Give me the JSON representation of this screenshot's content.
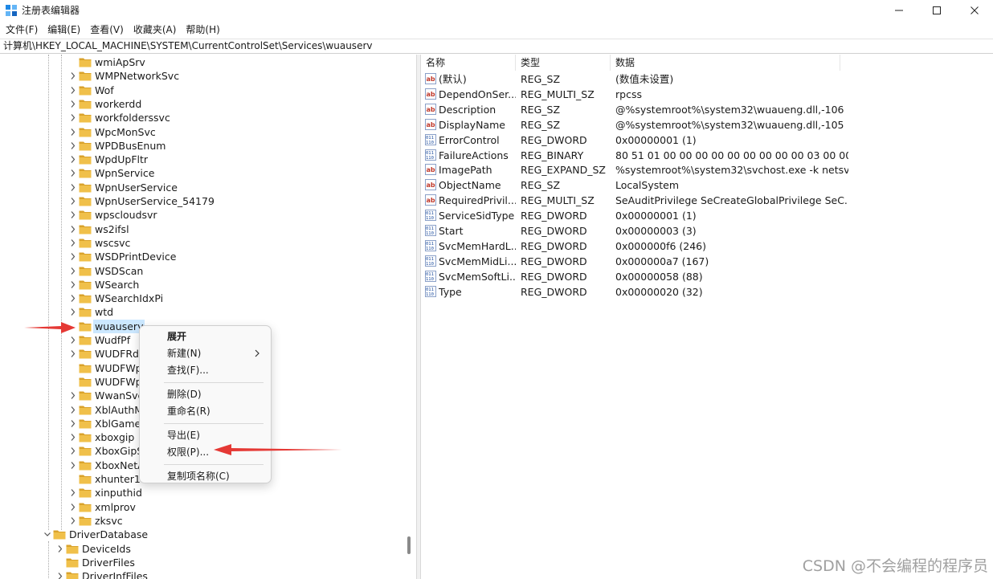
{
  "window": {
    "title": "注册表编辑器",
    "minimize_icon": "minimize-icon",
    "maximize_icon": "maximize-icon",
    "close_icon": "close-icon"
  },
  "menubar": [
    {
      "label": "文件(F)"
    },
    {
      "label": "编辑(E)"
    },
    {
      "label": "查看(V)"
    },
    {
      "label": "收藏夹(A)"
    },
    {
      "label": "帮助(H)"
    }
  ],
  "address": "计算机\\HKEY_LOCAL_MACHINE\\SYSTEM\\CurrentControlSet\\Services\\wuauserv",
  "tree": {
    "items": [
      {
        "label": "wmiApSrv",
        "level": 2,
        "expander": false
      },
      {
        "label": "WMPNetworkSvc",
        "level": 2,
        "expander": true
      },
      {
        "label": "Wof",
        "level": 2,
        "expander": true
      },
      {
        "label": "workerdd",
        "level": 2,
        "expander": true
      },
      {
        "label": "workfolderssvc",
        "level": 2,
        "expander": true
      },
      {
        "label": "WpcMonSvc",
        "level": 2,
        "expander": true
      },
      {
        "label": "WPDBusEnum",
        "level": 2,
        "expander": true
      },
      {
        "label": "WpdUpFltr",
        "level": 2,
        "expander": true
      },
      {
        "label": "WpnService",
        "level": 2,
        "expander": true
      },
      {
        "label": "WpnUserService",
        "level": 2,
        "expander": true
      },
      {
        "label": "WpnUserService_54179",
        "level": 2,
        "expander": true
      },
      {
        "label": "wpscloudsvr",
        "level": 2,
        "expander": true
      },
      {
        "label": "ws2ifsl",
        "level": 2,
        "expander": true
      },
      {
        "label": "wscsvc",
        "level": 2,
        "expander": true
      },
      {
        "label": "WSDPrintDevice",
        "level": 2,
        "expander": true
      },
      {
        "label": "WSDScan",
        "level": 2,
        "expander": true
      },
      {
        "label": "WSearch",
        "level": 2,
        "expander": true
      },
      {
        "label": "WSearchIdxPi",
        "level": 2,
        "expander": true
      },
      {
        "label": "wtd",
        "level": 2,
        "expander": true
      },
      {
        "label": "wuauserv",
        "level": 2,
        "expander": false,
        "selected": true
      },
      {
        "label": "WudfPf",
        "level": 2,
        "expander": true
      },
      {
        "label": "WUDFRd",
        "level": 2,
        "expander": true
      },
      {
        "label": "WUDFWp",
        "level": 2,
        "expander": false
      },
      {
        "label": "WUDFWp",
        "level": 2,
        "expander": false
      },
      {
        "label": "WwanSvc",
        "level": 2,
        "expander": true
      },
      {
        "label": "XblAuthM",
        "level": 2,
        "expander": true
      },
      {
        "label": "XblGameS",
        "level": 2,
        "expander": true
      },
      {
        "label": "xboxgip",
        "level": 2,
        "expander": true
      },
      {
        "label": "XboxGipS",
        "level": 2,
        "expander": true
      },
      {
        "label": "XboxNetA",
        "level": 2,
        "expander": true
      },
      {
        "label": "xhunter1",
        "level": 2,
        "expander": false
      },
      {
        "label": "xinputhid",
        "level": 2,
        "expander": true
      },
      {
        "label": "xmlprov",
        "level": 2,
        "expander": true
      },
      {
        "label": "zksvc",
        "level": 2,
        "expander": true
      },
      {
        "label": "DriverDatabase",
        "level": 0,
        "expander": true,
        "expanded": true
      },
      {
        "label": "DeviceIds",
        "level": 1,
        "expander": true
      },
      {
        "label": "DriverFiles",
        "level": 1,
        "expander": false
      },
      {
        "label": "DriverInfFiles",
        "level": 1,
        "expander": true
      }
    ]
  },
  "list": {
    "columns": [
      "名称",
      "类型",
      "数据"
    ],
    "rows": [
      {
        "icon": "string-value-icon",
        "name": "(默认)",
        "type": "REG_SZ",
        "data": "(数值未设置)"
      },
      {
        "icon": "string-value-icon",
        "name": "DependOnSer...",
        "type": "REG_MULTI_SZ",
        "data": "rpcss"
      },
      {
        "icon": "string-value-icon",
        "name": "Description",
        "type": "REG_SZ",
        "data": "@%systemroot%\\system32\\wuaueng.dll,-106"
      },
      {
        "icon": "string-value-icon",
        "name": "DisplayName",
        "type": "REG_SZ",
        "data": "@%systemroot%\\system32\\wuaueng.dll,-105"
      },
      {
        "icon": "binary-value-icon",
        "name": "ErrorControl",
        "type": "REG_DWORD",
        "data": "0x00000001 (1)"
      },
      {
        "icon": "binary-value-icon",
        "name": "FailureActions",
        "type": "REG_BINARY",
        "data": "80 51 01 00 00 00 00 00 00 00 00 00 03 00 00 ..."
      },
      {
        "icon": "string-value-icon",
        "name": "ImagePath",
        "type": "REG_EXPAND_SZ",
        "data": "%systemroot%\\system32\\svchost.exe -k netsv..."
      },
      {
        "icon": "string-value-icon",
        "name": "ObjectName",
        "type": "REG_SZ",
        "data": "LocalSystem"
      },
      {
        "icon": "string-value-icon",
        "name": "RequiredPrivil...",
        "type": "REG_MULTI_SZ",
        "data": "SeAuditPrivilege SeCreateGlobalPrivilege SeC..."
      },
      {
        "icon": "binary-value-icon",
        "name": "ServiceSidType",
        "type": "REG_DWORD",
        "data": "0x00000001 (1)"
      },
      {
        "icon": "binary-value-icon",
        "name": "Start",
        "type": "REG_DWORD",
        "data": "0x00000003 (3)"
      },
      {
        "icon": "binary-value-icon",
        "name": "SvcMemHardL...",
        "type": "REG_DWORD",
        "data": "0x000000f6 (246)"
      },
      {
        "icon": "binary-value-icon",
        "name": "SvcMemMidLi...",
        "type": "REG_DWORD",
        "data": "0x000000a7 (167)"
      },
      {
        "icon": "binary-value-icon",
        "name": "SvcMemSoftLi...",
        "type": "REG_DWORD",
        "data": "0x00000058 (88)"
      },
      {
        "icon": "binary-value-icon",
        "name": "Type",
        "type": "REG_DWORD",
        "data": "0x00000020 (32)"
      }
    ]
  },
  "context_menu": {
    "items": [
      {
        "label": "展开",
        "bold": true
      },
      {
        "label": "新建(N)",
        "submenu": true
      },
      {
        "label": "查找(F)..."
      },
      {
        "separator": true
      },
      {
        "label": "删除(D)"
      },
      {
        "label": "重命名(R)"
      },
      {
        "separator": true
      },
      {
        "label": "导出(E)"
      },
      {
        "label": "权限(P)..."
      },
      {
        "separator": true
      },
      {
        "label": "复制项名称(C)"
      }
    ]
  },
  "annotations": {
    "arrow_color": "#e53935"
  },
  "watermark": "CSDN @不会编程的程序员",
  "colors": {
    "selection": "#cce8ff",
    "folder": "#f0c04a",
    "folder_dark": "#d9a22b"
  }
}
